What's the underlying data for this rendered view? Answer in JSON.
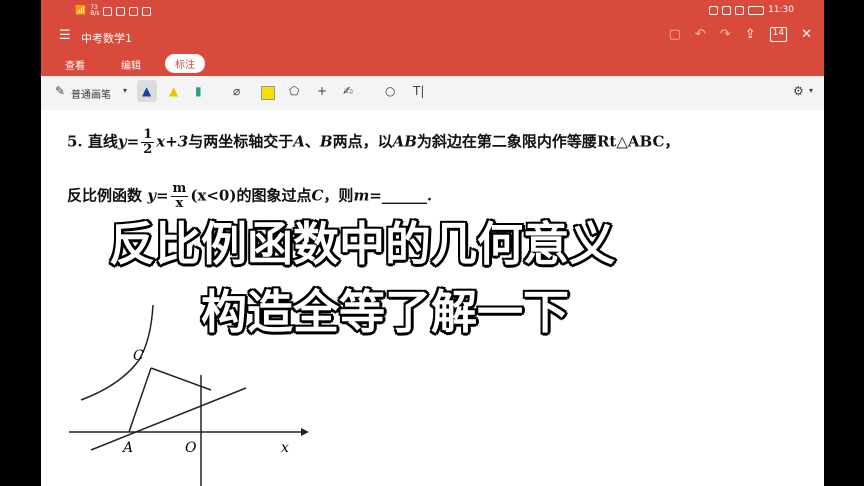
{
  "status": {
    "speed": "73\nB/s",
    "time": "11:30"
  },
  "titlebar": {
    "title": "中考数学1",
    "page_count": "14"
  },
  "tabs": [
    {
      "label": "查看"
    },
    {
      "label": "编辑"
    },
    {
      "label": "标注"
    }
  ],
  "toolbar": {
    "pen_label": "普通画笔",
    "text_tool": "T|"
  },
  "problem": {
    "number": "5.",
    "line1_a": "直线",
    "y_eq": "y=",
    "frac1_num": "1",
    "frac1_den": "2",
    "line1_b": "x+3",
    "line1_c": "与两坐标轴交于",
    "A": "A",
    "sep": "、",
    "B": "B",
    "line1_d": "两点，以",
    "AB": "AB",
    "line1_e": "为斜边在第二象限内作等腰",
    "rt": "Rt△ABC",
    "comma": "，",
    "line2_a": "反比例函数",
    "y_eq2": "y=",
    "frac2_num": "m",
    "frac2_den": "x",
    "line2_b": "(x<0)的图象过点",
    "C": "C",
    "line2_c": "，则",
    "m_eq": "m=",
    "blank": "______."
  },
  "captions": {
    "line1": "反比例函数中的几何意义",
    "line2": "构造全等了解一下"
  },
  "diagram": {
    "label_C": "C",
    "label_A": "A",
    "label_O": "O",
    "label_x": "x"
  },
  "colors": {
    "accent": "#d84a3c"
  }
}
